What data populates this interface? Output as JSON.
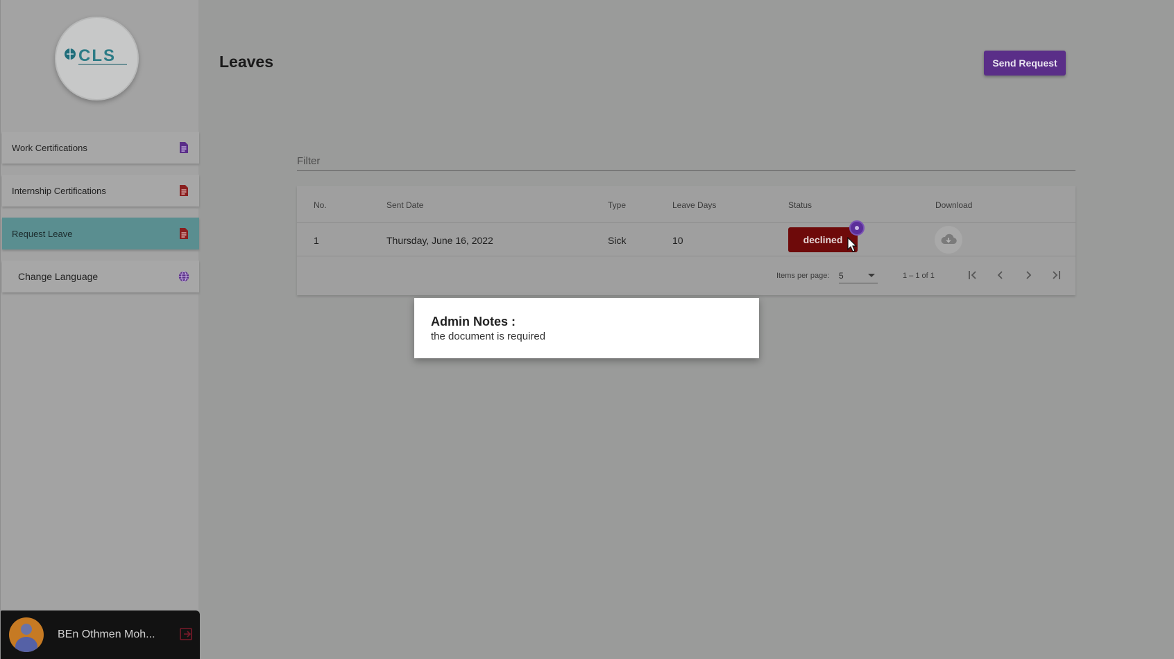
{
  "sidebar": {
    "logo_text": "CLS",
    "items": [
      {
        "label": "Work Certifications",
        "icon": "document-icon",
        "icon_color": "#5a2e88"
      },
      {
        "label": "Internship Certifications",
        "icon": "document-icon",
        "icon_color": "#8a1f1f"
      },
      {
        "label": "Request Leave",
        "icon": "document-icon",
        "icon_color": "#8a1f1f",
        "active": true
      },
      {
        "label": "Change Language",
        "icon": "globe-icon",
        "icon_color": "#5a2e88"
      }
    ],
    "user": {
      "name": "BEn Othmen Moh...",
      "avatar_icon": "user-avatar",
      "logout_icon": "logout-icon"
    }
  },
  "header": {
    "title": "Leaves",
    "send_request_label": "Send Request"
  },
  "filter": {
    "placeholder": "Filter"
  },
  "table": {
    "columns": [
      "No.",
      "Sent Date",
      "Type",
      "Leave Days",
      "Status",
      "Download"
    ],
    "rows": [
      {
        "no": "1",
        "sent_date": "Thursday, June 16, 2022",
        "type": "Sick",
        "leave_days": "10",
        "status": "declined",
        "download_icon": "cloud-download-icon"
      }
    ]
  },
  "paginator": {
    "items_per_page_label": "Items per page:",
    "items_per_page_value": "5",
    "range": "1 – 1 of 1"
  },
  "notes_popup": {
    "title": "Admin Notes :",
    "text": "the document is required"
  },
  "colors": {
    "accent": "#5a2e88",
    "active_nav": "#5a8e90",
    "declined": "#6e0a0a",
    "overlay_bg": "#9a9b9a"
  }
}
